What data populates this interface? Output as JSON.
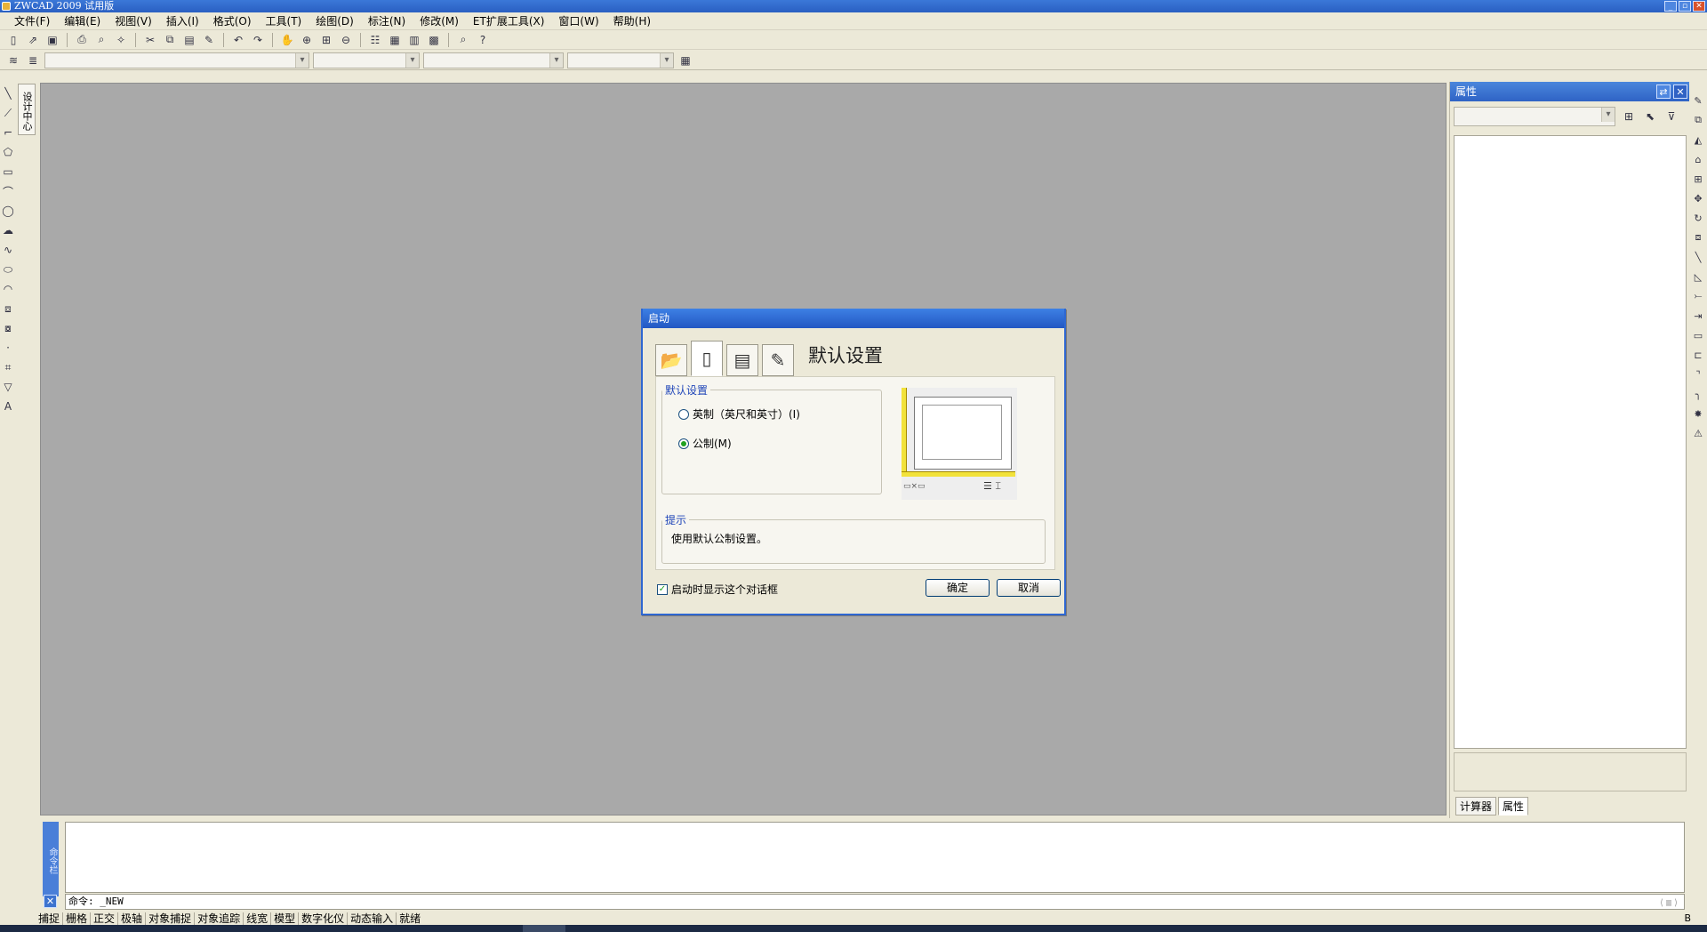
{
  "window": {
    "title": "ZWCAD 2009 试用版",
    "win_buttons": [
      "_",
      "▫",
      "✕"
    ]
  },
  "menubar": {
    "items": [
      "文件(F)",
      "编辑(E)",
      "视图(V)",
      "插入(I)",
      "格式(O)",
      "工具(T)",
      "绘图(D)",
      "标注(N)",
      "修改(M)",
      "ET扩展工具(X)",
      "窗口(W)",
      "帮助(H)"
    ]
  },
  "toolbar1_icons": [
    "new-icon",
    "open-icon",
    "save-icon",
    "print-icon",
    "print-preview-icon",
    "publish-icon",
    "cut-icon",
    "copy-icon",
    "paste-icon",
    "match-properties-icon",
    "undo-icon",
    "redo-icon",
    "pan-icon",
    "zoom-realtime-icon",
    "zoom-window-icon",
    "zoom-previous-icon",
    "properties-icon",
    "design-center-icon",
    "tool-palette-icon",
    "calculator-icon",
    "find-icon",
    "help-icon"
  ],
  "design_center_tab": {
    "label": "设计中心"
  },
  "properties_panel": {
    "title": "属性",
    "tabs": [
      "计算器",
      "属性"
    ],
    "active_tab": "属性"
  },
  "command": {
    "side_label": "命令栏",
    "prompt": "命令: _NEW"
  },
  "statusbar": {
    "items": [
      "捕捉",
      "栅格",
      "正交",
      "极轴",
      "对象捕捉",
      "对象追踪",
      "线宽",
      "模型",
      "数字化仪",
      "动态输入",
      "就绪"
    ],
    "right_label": "B"
  },
  "dialog": {
    "title": "启动",
    "heading": "默认设置",
    "tabs": [
      "open-drawing-icon",
      "start-from-scratch-icon",
      "use-template-icon",
      "use-wizard-icon"
    ],
    "active_tab_index": 1,
    "defaults_group": {
      "legend": "默认设置",
      "options": [
        {
          "label": "英制（英尺和英寸）(I)",
          "checked": false
        },
        {
          "label": "公制(M)",
          "checked": true
        }
      ]
    },
    "hint_group": {
      "legend": "提示",
      "text": "使用默认公制设置。"
    },
    "show_on_startup": {
      "label": "启动时显示这个对话框",
      "checked": true
    },
    "buttons": {
      "ok": "确定",
      "cancel": "取消"
    }
  }
}
